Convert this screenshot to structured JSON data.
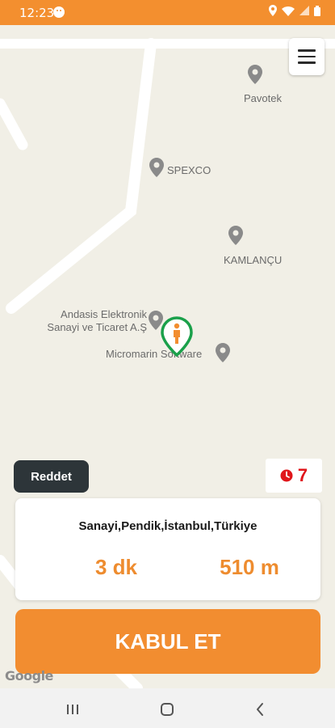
{
  "status_bar": {
    "time": "12:23",
    "icons": [
      "face-icon",
      "location-icon",
      "wifi-icon",
      "signal-icon",
      "battery-icon"
    ]
  },
  "map": {
    "pois": [
      {
        "name": "Pavotek"
      },
      {
        "name": "SPEXCO"
      },
      {
        "name": "KAMLANÇU"
      },
      {
        "name": "Andasis Elektronik Sanayi ve Ticaret A.Ş"
      },
      {
        "name": "Micromarin Software"
      }
    ],
    "google_logo": "Google"
  },
  "controls": {
    "reject_label": "Reddet",
    "timer_value": "7",
    "accept_label": "KABUL ET"
  },
  "info": {
    "address": "Sanayi,Pendik,İstanbul,Türkiye",
    "duration": "3 dk",
    "distance": "510 m"
  },
  "colors": {
    "accent": "#f28d30",
    "duration_text": "#ee8c2f",
    "timer": "#e0161b",
    "marker": "#1aa04a",
    "reject_bg": "#2d3539"
  }
}
